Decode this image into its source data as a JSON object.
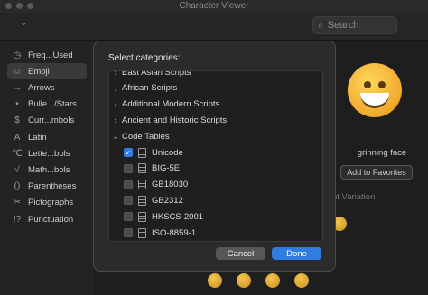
{
  "window": {
    "title": "Character Viewer"
  },
  "search": {
    "placeholder": "Search"
  },
  "sidebar": {
    "items": [
      {
        "icon": "clock-icon",
        "glyph": "◷",
        "label": "Freq...Used",
        "selected": false
      },
      {
        "icon": "smiley-icon",
        "glyph": "☺",
        "label": "Emoji",
        "selected": true
      },
      {
        "icon": "arrow-icon",
        "glyph": "→",
        "label": "Arrows",
        "selected": false
      },
      {
        "icon": "bullet-icon",
        "glyph": "•",
        "label": "Bulle.../Stars",
        "selected": false
      },
      {
        "icon": "currency-icon",
        "glyph": "$",
        "label": "Curr...mbols",
        "selected": false
      },
      {
        "icon": "latin-icon",
        "glyph": "A",
        "label": "Latin",
        "selected": false
      },
      {
        "icon": "letterlike-icon",
        "glyph": "℃",
        "label": "Lette...bols",
        "selected": false
      },
      {
        "icon": "math-icon",
        "glyph": "√",
        "label": "Math...bols",
        "selected": false
      },
      {
        "icon": "parentheses-icon",
        "glyph": "()",
        "label": "Parentheses",
        "selected": false
      },
      {
        "icon": "pictograph-icon",
        "glyph": "✂",
        "label": "Pictographs",
        "selected": false
      },
      {
        "icon": "punctuation-icon",
        "glyph": "!?",
        "label": "Punctuation",
        "selected": false
      }
    ]
  },
  "preview": {
    "emoji_name": "grinning face",
    "add_favorites_label": "Add to Favorites",
    "variation_label": "nt Variation"
  },
  "dialog": {
    "title": "Select categories:",
    "rows": [
      {
        "kind": "group",
        "label": "East Asian Scripts",
        "expanded": false
      },
      {
        "kind": "group",
        "label": "African Scripts",
        "expanded": false
      },
      {
        "kind": "group",
        "label": "Additional Modern Scripts",
        "expanded": false
      },
      {
        "kind": "group",
        "label": "Ancient and Historic Scripts",
        "expanded": false
      },
      {
        "kind": "group",
        "label": "Code Tables",
        "expanded": true
      },
      {
        "kind": "item",
        "label": "Unicode",
        "checked": true
      },
      {
        "kind": "item",
        "label": "BIG-5E",
        "checked": false
      },
      {
        "kind": "item",
        "label": "GB18030",
        "checked": false
      },
      {
        "kind": "item",
        "label": "GB2312",
        "checked": false
      },
      {
        "kind": "item",
        "label": "HKSCS-2001",
        "checked": false
      },
      {
        "kind": "item",
        "label": "ISO-8859-1",
        "checked": false
      }
    ],
    "cancel_label": "Cancel",
    "done_label": "Done"
  },
  "colors": {
    "accent": "#2f7de1",
    "background": "#1e1e1e",
    "dialog": "#2b2b2b"
  }
}
